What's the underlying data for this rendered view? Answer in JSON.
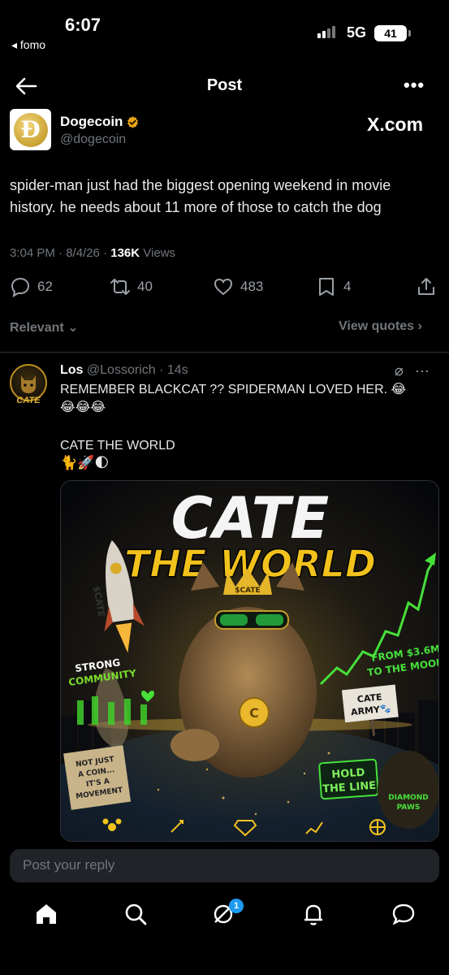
{
  "status_bar": {
    "time": "6:07",
    "back_app": "◂ fomo",
    "network": "5G",
    "battery": "41"
  },
  "header": {
    "title": "Post",
    "more": "•••"
  },
  "post": {
    "author_name": "Dogecoin",
    "author_handle": "@dogecoin",
    "source": "X.com",
    "text": "spider-man just had the biggest opening weekend in movie history. he needs about 11 more of those to catch the dog",
    "time": "3:04 PM · 8/4/26 · ",
    "views_count": "136K",
    "views_label": " Views",
    "replies": "62",
    "reposts": "40",
    "likes": "483",
    "bookmarks": "4"
  },
  "filters": {
    "relevant": "Relevant ⌄",
    "view_quotes": "View quotes ›"
  },
  "reply": {
    "avatar_text": "CATE",
    "name": "Los",
    "handle_time": "@Lossorich · 14s",
    "line1": "REMEMBER BLACKCAT ?? SPIDERMAN LOVED HER. 😂",
    "line1b": "😂😂😂",
    "line2": "CATE THE WORLD",
    "emojis": "🐈🚀🌓",
    "image": {
      "title1": "CATE",
      "title2": "THE WORLD",
      "rocket_label": "$CATE",
      "crown_label": "$CATE",
      "strong": "STRONG",
      "community": "COMMUNITY",
      "from_line1": "FROM $3.6M",
      "from_line2": "TO THE MOON",
      "cate_army1": "CATE",
      "cate_army2": "ARMY🐾",
      "sign1": "NOT JUST",
      "sign2": "A COIN...",
      "sign3": "IT'S A",
      "sign4": "MOVEMENT",
      "hold1": "HOLD",
      "hold2": "THE LINE",
      "diamond1": "DIAMOND",
      "diamond2": "PAWS"
    }
  },
  "reply_box": {
    "placeholder": "Post your reply"
  },
  "nav": {
    "badge": "1"
  }
}
